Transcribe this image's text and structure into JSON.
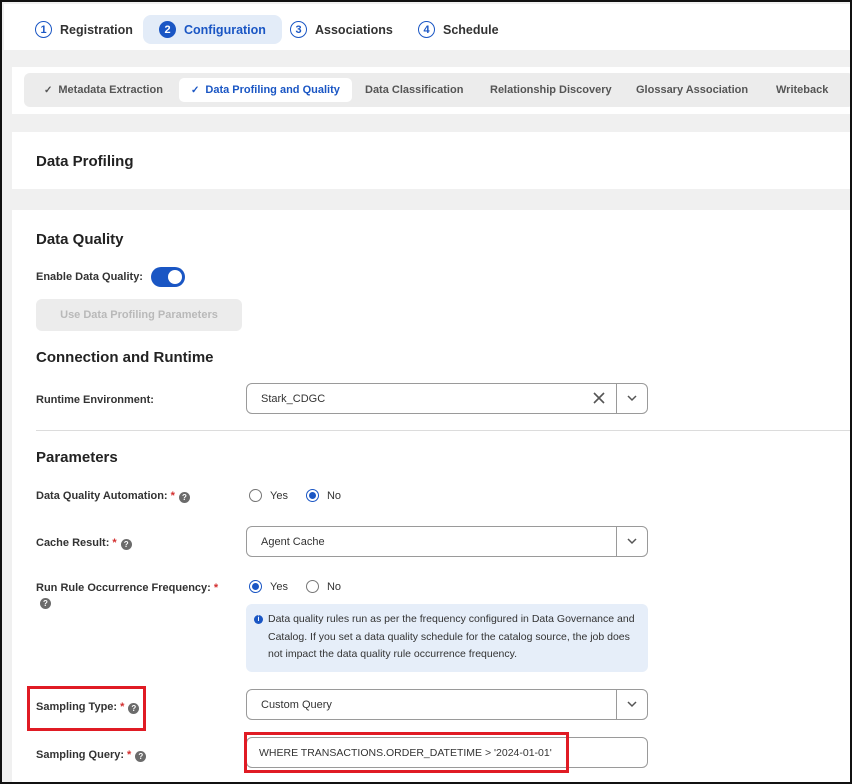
{
  "steps": [
    {
      "num": "1",
      "label": "Registration"
    },
    {
      "num": "2",
      "label": "Configuration"
    },
    {
      "num": "3",
      "label": "Associations"
    },
    {
      "num": "4",
      "label": "Schedule"
    }
  ],
  "subtabs": [
    {
      "label": "Metadata Extraction",
      "check": "✓"
    },
    {
      "label": "Data Profiling and Quality",
      "check": "✓"
    },
    {
      "label": "Data Classification"
    },
    {
      "label": "Relationship Discovery"
    },
    {
      "label": "Glossary Association"
    },
    {
      "label": "Writeback"
    }
  ],
  "profiling": {
    "title": "Data Profiling"
  },
  "quality": {
    "title": "Data Quality",
    "enable_label": "Enable Data Quality:",
    "enable_value": true,
    "use_profiling_button": "Use Data Profiling Parameters"
  },
  "connection": {
    "title": "Connection and Runtime",
    "runtime_label": "Runtime Environment:",
    "runtime_value": "Stark_CDGC"
  },
  "parameters": {
    "title": "Parameters",
    "automation_label": "Data Quality Automation:",
    "automation_options": [
      "Yes",
      "No"
    ],
    "automation_selected": "No",
    "cache_label": "Cache Result:",
    "cache_value": "Agent Cache",
    "frequency_label": "Run Rule Occurrence Frequency:",
    "frequency_options": [
      "Yes",
      "No"
    ],
    "frequency_selected": "Yes",
    "info_text": "Data quality rules run as per the frequency configured in Data Governance and Catalog. If you set a data quality schedule for the catalog source, the job does not impact the data quality rule occurrence frequency.",
    "sampling_type_label": "Sampling Type:",
    "sampling_type_value": "Custom Query",
    "sampling_query_label": "Sampling Query:",
    "sampling_query_value": "WHERE TRANSACTIONS.ORDER_DATETIME > '2024-01-01'"
  },
  "required_mark": "*",
  "help_glyph": "?",
  "info_glyph": "i",
  "colors": {
    "accent": "#1a56c4",
    "highlight": "#e01b24",
    "required": "#d32f2f"
  }
}
